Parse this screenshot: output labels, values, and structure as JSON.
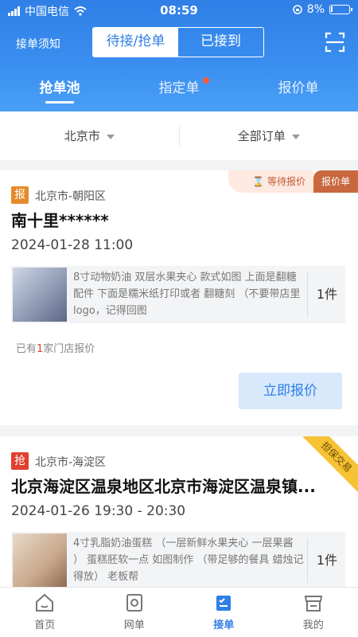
{
  "status": {
    "carrier": "中国电信",
    "time": "08:59",
    "battery": "8%",
    "battery_level": 0.08
  },
  "topbar": {
    "rules_label": "接单须知",
    "seg_left": "待接/抢单",
    "seg_right": "已接到"
  },
  "tabs": [
    {
      "label": "抢单池"
    },
    {
      "label": "指定单"
    },
    {
      "label": "报价单"
    }
  ],
  "filters": {
    "city": "北京市",
    "orders": "全部订单"
  },
  "cards": [
    {
      "badge": "报",
      "location": "北京市-朝阳区",
      "title": "南十里******",
      "datetime": "2024-01-28 11:00",
      "description": "8寸动物奶油 双层水果夹心 款式如图 上面是翻糖配件 下面是糯米纸打印或者 翻糖刻 （不要带店里logo，记得回图",
      "qty": "1件",
      "count_prefix": "已有",
      "count_num": "1",
      "count_suffix": "家门店报价",
      "status_tag": "等待报价",
      "type_tag": "报价单",
      "button": "立即报价"
    },
    {
      "badge": "抢",
      "location": "北京市-海淀区",
      "title": "北京海淀区温泉地区北京市海淀区温泉镇...",
      "datetime": "2024-01-26 19:30 - 20:30",
      "description": "4寸乳脂奶油蛋糕 （一层新鲜水果夹心 一层果酱 ） 蛋糕胚软一点 如图制作 （带足够的餐具 蜡烛记得放） 老板帮",
      "qty": "1件",
      "ribbon": "担保交易"
    }
  ],
  "nav": [
    {
      "label": "首页"
    },
    {
      "label": "网单"
    },
    {
      "label": "接单"
    },
    {
      "label": "我的"
    }
  ],
  "colors": {
    "primary": "#2f7fe6",
    "accent_red": "#e0402f",
    "accent_orange": "#e58b2a"
  }
}
